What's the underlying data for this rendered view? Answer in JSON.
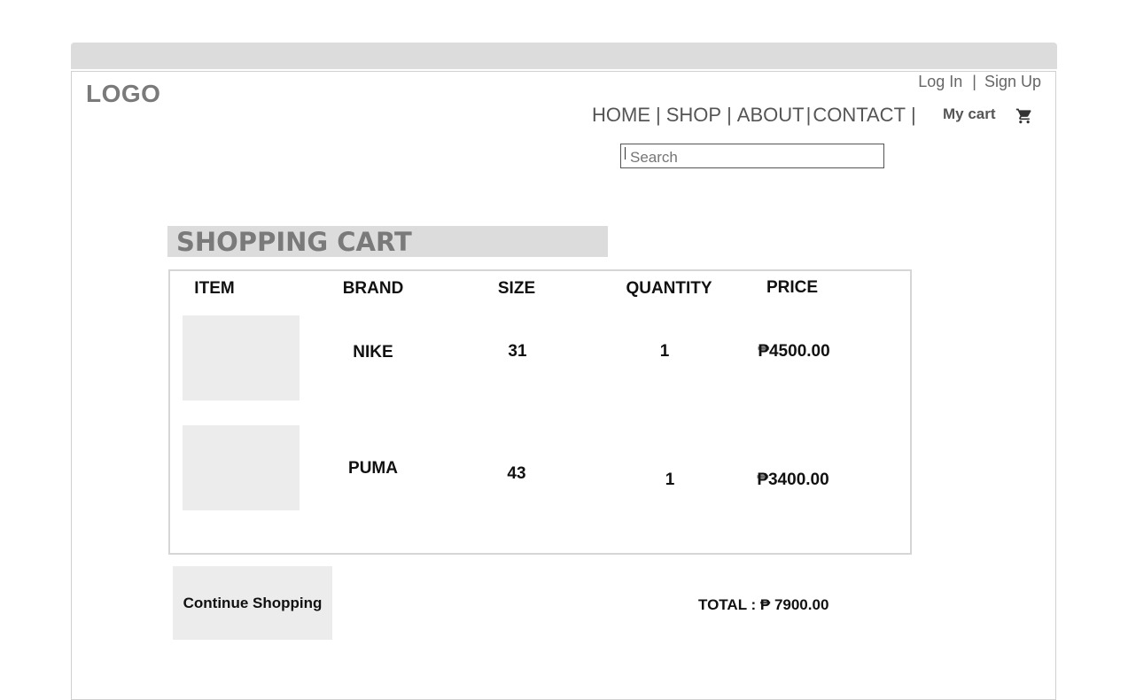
{
  "header": {
    "logo": "LOGO",
    "auth": {
      "login": "Log In",
      "separator": "|",
      "signup": "Sign Up"
    },
    "nav": [
      {
        "label": "HOME"
      },
      {
        "label": "SHOP"
      },
      {
        "label": "ABOUT"
      },
      {
        "label": "CONTACT"
      }
    ],
    "nav_separator": "|",
    "cart_label": "My cart",
    "cart_icon": "shopping-cart-icon"
  },
  "search": {
    "placeholder": "Search",
    "value": ""
  },
  "cart": {
    "title": "SHOPPING CART",
    "columns": [
      "ITEM",
      "BRAND",
      "SIZE",
      "QUANTITY",
      "PRICE"
    ],
    "rows": [
      {
        "brand": "NIKE",
        "size": "31",
        "quantity": "1",
        "price": "₱4500.00"
      },
      {
        "brand": "PUMA",
        "size": "43",
        "quantity": "1",
        "price": "₱3400.00"
      }
    ],
    "continue_label": "Continue Shopping",
    "total": "TOTAL : ₱ 7900.00"
  }
}
